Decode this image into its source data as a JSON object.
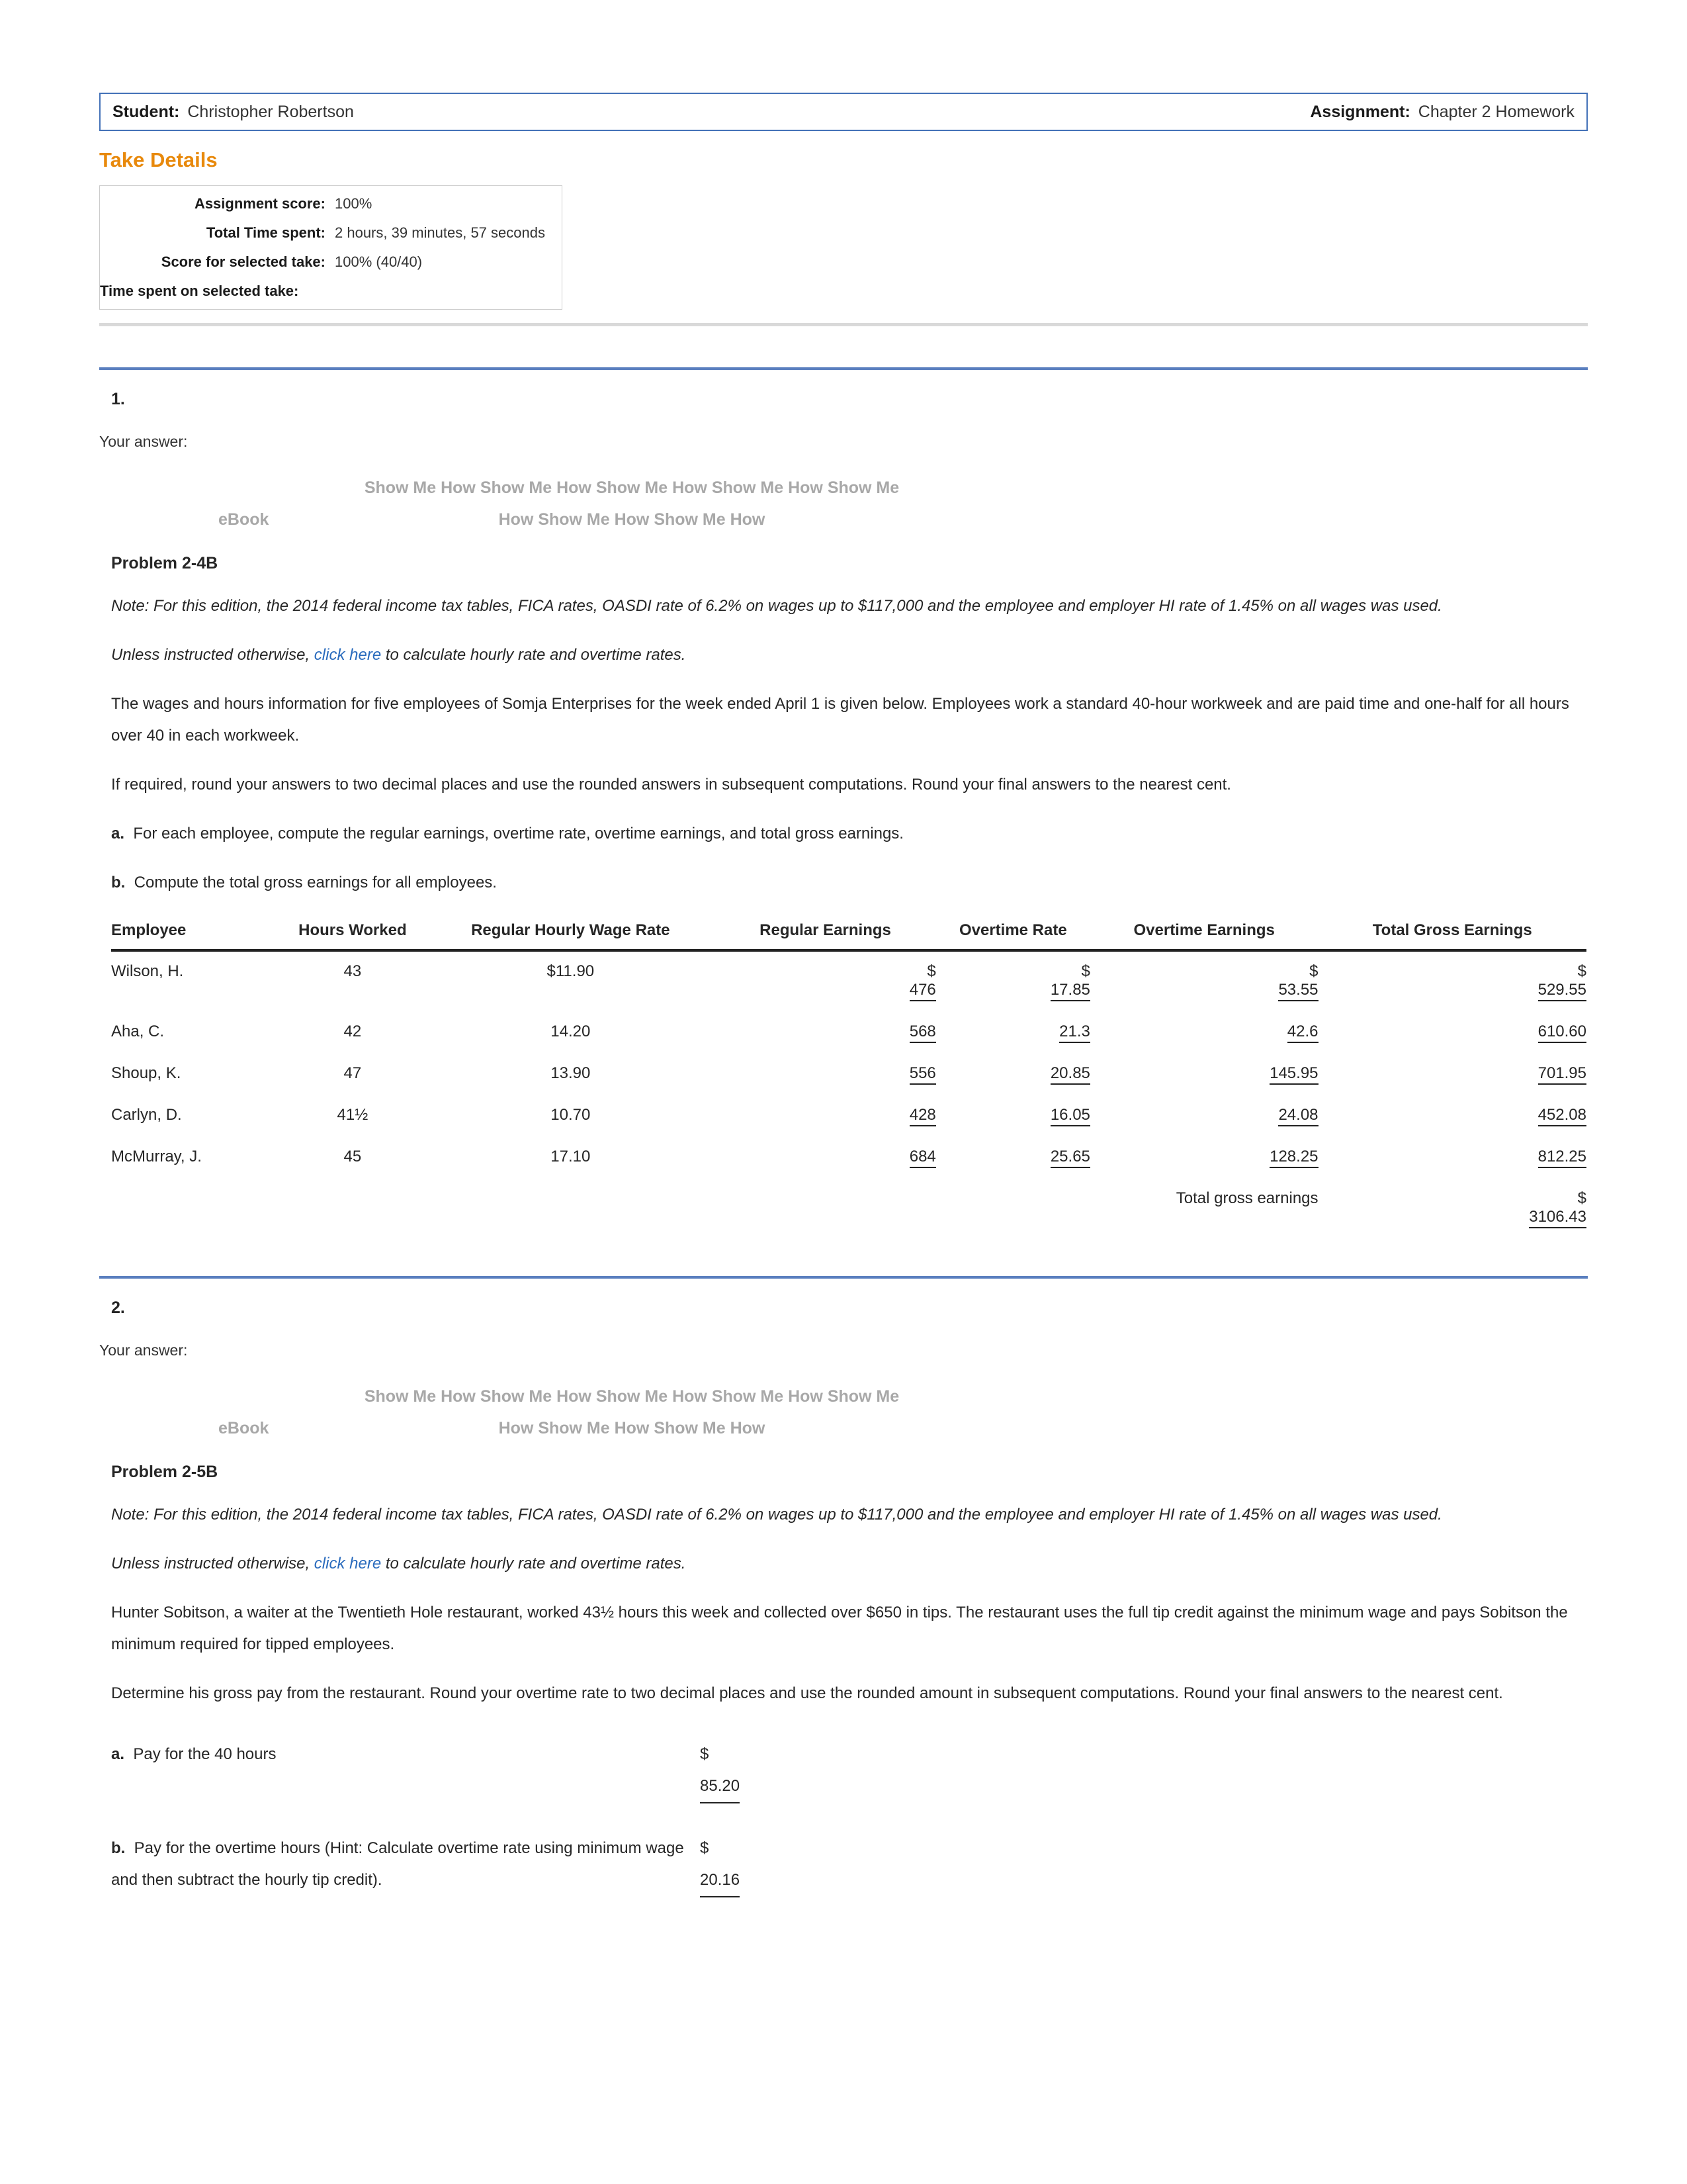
{
  "header": {
    "student_label": "Student:",
    "student_name": "Christopher Robertson",
    "assignment_label": "Assignment:",
    "assignment_name": "Chapter 2 Homework"
  },
  "take_details": {
    "title": "Take Details",
    "rows": [
      {
        "label": "Assignment score:",
        "value": "100%"
      },
      {
        "label": "Total Time spent:",
        "value": "2 hours, 39 minutes, 57 seconds"
      },
      {
        "label": "Score for selected take:",
        "value": "100% (40/40)"
      },
      {
        "label": "Time spent on selected take:",
        "value": ""
      }
    ]
  },
  "questions": [
    {
      "number": "1.",
      "your_answer_label": "Your answer:",
      "show_me_how_text": "Show Me How   Show Me How   Show Me How   Show Me How   Show Me How   Show Me How   Show Me How",
      "ebook_label": "eBook",
      "problem_title": "Problem 2-4B",
      "note": "Note: For this edition, the 2014 federal income tax tables, FICA rates, OASDI rate of 6.2% on wages up to $117,000 and the employee and employer HI rate of 1.45% on all wages was used.",
      "instructed_pre": "Unless instructed otherwise, ",
      "instructed_link": "click here",
      "instructed_post": " to calculate hourly rate and overtime rates.",
      "para1": "The wages and hours information for five employees of Somja Enterprises for the week ended April 1 is given below. Employees work a standard 40-hour workweek and are paid time and one-half for all hours over 40 in each workweek.",
      "para2": "If required, round your answers to two decimal places and use the rounded answers in subsequent computations. Round your final answers to the nearest cent.",
      "item_a_marker": "a.",
      "item_a_text": "For each employee, compute the regular earnings, overtime rate, overtime earnings, and total gross earnings.",
      "item_b_marker": "b.",
      "item_b_text": "Compute the total gross earnings for all employees."
    },
    {
      "number": "2.",
      "your_answer_label": "Your answer:",
      "show_me_how_text": "Show Me How   Show Me How   Show Me How   Show Me How   Show Me How   Show Me How   Show Me How",
      "ebook_label": "eBook",
      "problem_title": "Problem 2-5B",
      "note": "Note: For this edition, the 2014 federal income tax tables, FICA rates, OASDI rate of 6.2% on wages up to $117,000 and the employee and employer HI rate of 1.45% on all wages was used.",
      "instructed_pre": "Unless instructed otherwise, ",
      "instructed_link": "click here",
      "instructed_post": " to calculate hourly rate and overtime rates.",
      "para1": "Hunter Sobitson, a waiter at the Twentieth Hole restaurant, worked 43½ hours this week and collected over $650 in tips. The restaurant uses the full tip credit against the minimum wage and pays Sobitson the minimum required for tipped employees.",
      "para2": "Determine his gross pay from the restaurant. Round your overtime rate to two decimal places and use the rounded amount in subsequent computations. Round your final answers to the nearest cent.",
      "parts": [
        {
          "marker": "a.",
          "text": "Pay for the 40 hours",
          "currency": "$",
          "value": "85.20"
        },
        {
          "marker": "b.",
          "text": "Pay for the overtime hours (Hint: Calculate overtime rate using minimum wage and then subtract the hourly tip credit).",
          "currency": "$",
          "value": "20.16"
        }
      ]
    }
  ],
  "earnings_table": {
    "columns": [
      "Employee",
      "Hours Worked",
      "Regular Hourly Wage Rate",
      "Regular Earnings",
      "Overtime Rate",
      "Overtime Earnings",
      "Total Gross Earnings"
    ],
    "currency_symbol": "$",
    "rows": [
      {
        "employee": "Wilson, H.",
        "hours": "43",
        "rate": "$11.90",
        "regular_earnings": "476",
        "overtime_rate": "17.85",
        "overtime_earnings": "53.55",
        "total_gross": "529.55",
        "show_dollar": true
      },
      {
        "employee": "Aha, C.",
        "hours": "42",
        "rate": "14.20",
        "regular_earnings": "568",
        "overtime_rate": "21.3",
        "overtime_earnings": "42.6",
        "total_gross": "610.60",
        "show_dollar": false
      },
      {
        "employee": "Shoup, K.",
        "hours": "47",
        "rate": "13.90",
        "regular_earnings": "556",
        "overtime_rate": "20.85",
        "overtime_earnings": "145.95",
        "total_gross": "701.95",
        "show_dollar": false
      },
      {
        "employee": "Carlyn, D.",
        "hours": "41½",
        "rate": "10.70",
        "regular_earnings": "428",
        "overtime_rate": "16.05",
        "overtime_earnings": "24.08",
        "total_gross": "452.08",
        "show_dollar": false
      },
      {
        "employee": "McMurray, J.",
        "hours": "45",
        "rate": "17.10",
        "regular_earnings": "684",
        "overtime_rate": "25.65",
        "overtime_earnings": "128.25",
        "total_gross": "812.25",
        "show_dollar": false
      }
    ],
    "total_label": "Total gross earnings",
    "total_currency": "$",
    "total_value": "3106.43"
  },
  "colors": {
    "accent_orange": "#e8890c",
    "link_blue": "#2a6bbd",
    "rule_blue": "#5a7fbf",
    "header_border": "#4472b8",
    "muted_grey": "#a8a8a8"
  }
}
